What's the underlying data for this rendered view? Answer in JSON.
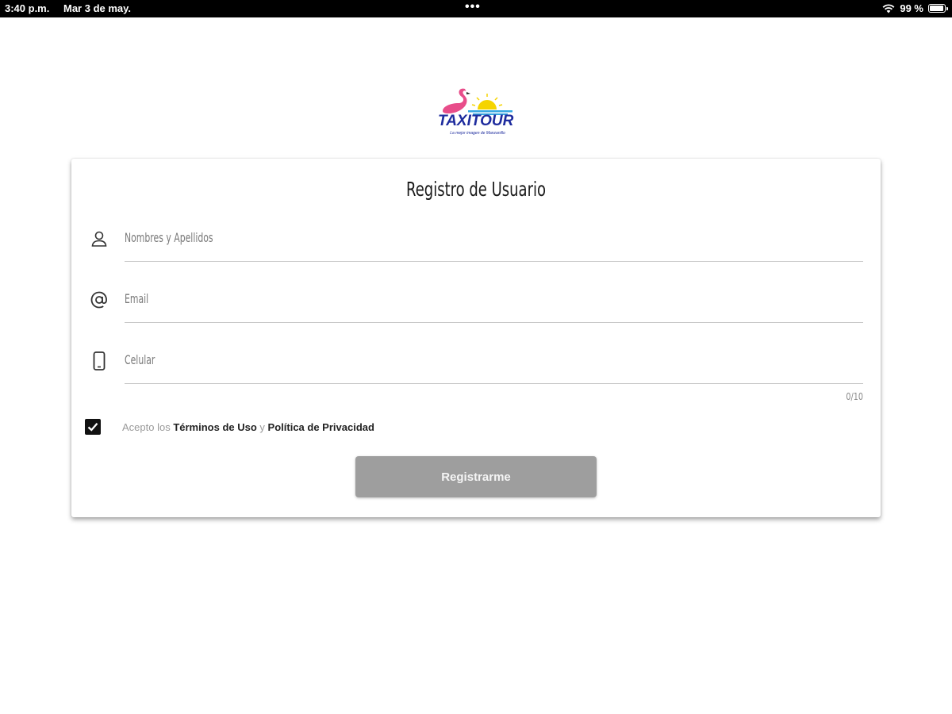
{
  "status_bar": {
    "time": "3:40 p.m.",
    "date": "Mar 3 de may.",
    "center_dots": "•••",
    "battery": "99 %",
    "battery_level_percent": 99
  },
  "logo": {
    "wordmark": "TAXITOUR",
    "tagline": "La mejor imagen de Manzanillo",
    "colors": {
      "wordmark": "#1e2c9e",
      "flamingo": "#e84d8a",
      "sun": "#f5d400",
      "waves": "#35a7e0"
    }
  },
  "form": {
    "title": "Registro de Usuario",
    "fields": [
      {
        "icon": "user-icon",
        "placeholder": "Nombres y Apellidos",
        "value": ""
      },
      {
        "icon": "at-sign-icon",
        "placeholder": "Email",
        "value": ""
      },
      {
        "icon": "mobile-phone-icon",
        "placeholder": "Celular",
        "value": ""
      }
    ],
    "phone_counter": "0/10",
    "terms": {
      "checked": true,
      "prefix": "Acepto los",
      "terms_link": "Términos de Uso",
      "joiner": "y",
      "privacy_link": "Política de Privacidad"
    },
    "submit_label": "Registrarme",
    "submit_color": "#9e9e9e"
  }
}
